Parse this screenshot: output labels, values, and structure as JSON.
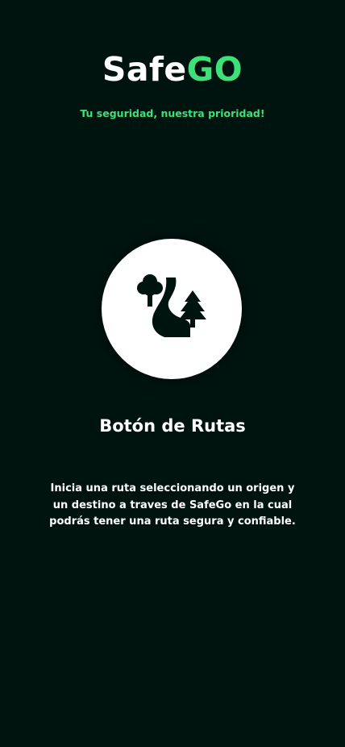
{
  "app": {
    "logo_part1": "Safe",
    "logo_part2": "GO",
    "tagline": "Tu seguridad, nuestra prioridad!"
  },
  "feature": {
    "icon": "forest-road-icon",
    "title": "Botón de Rutas",
    "description": "Inicia una ruta seleccionando un origen y un destino a traves de SafeGo en la cual podrás tener una ruta segura y confiable."
  },
  "colors": {
    "background": "#00140f",
    "accent": "#3ee07a",
    "text": "#ffffff",
    "icon_fill": "#00140f",
    "circle": "#ffffff"
  }
}
